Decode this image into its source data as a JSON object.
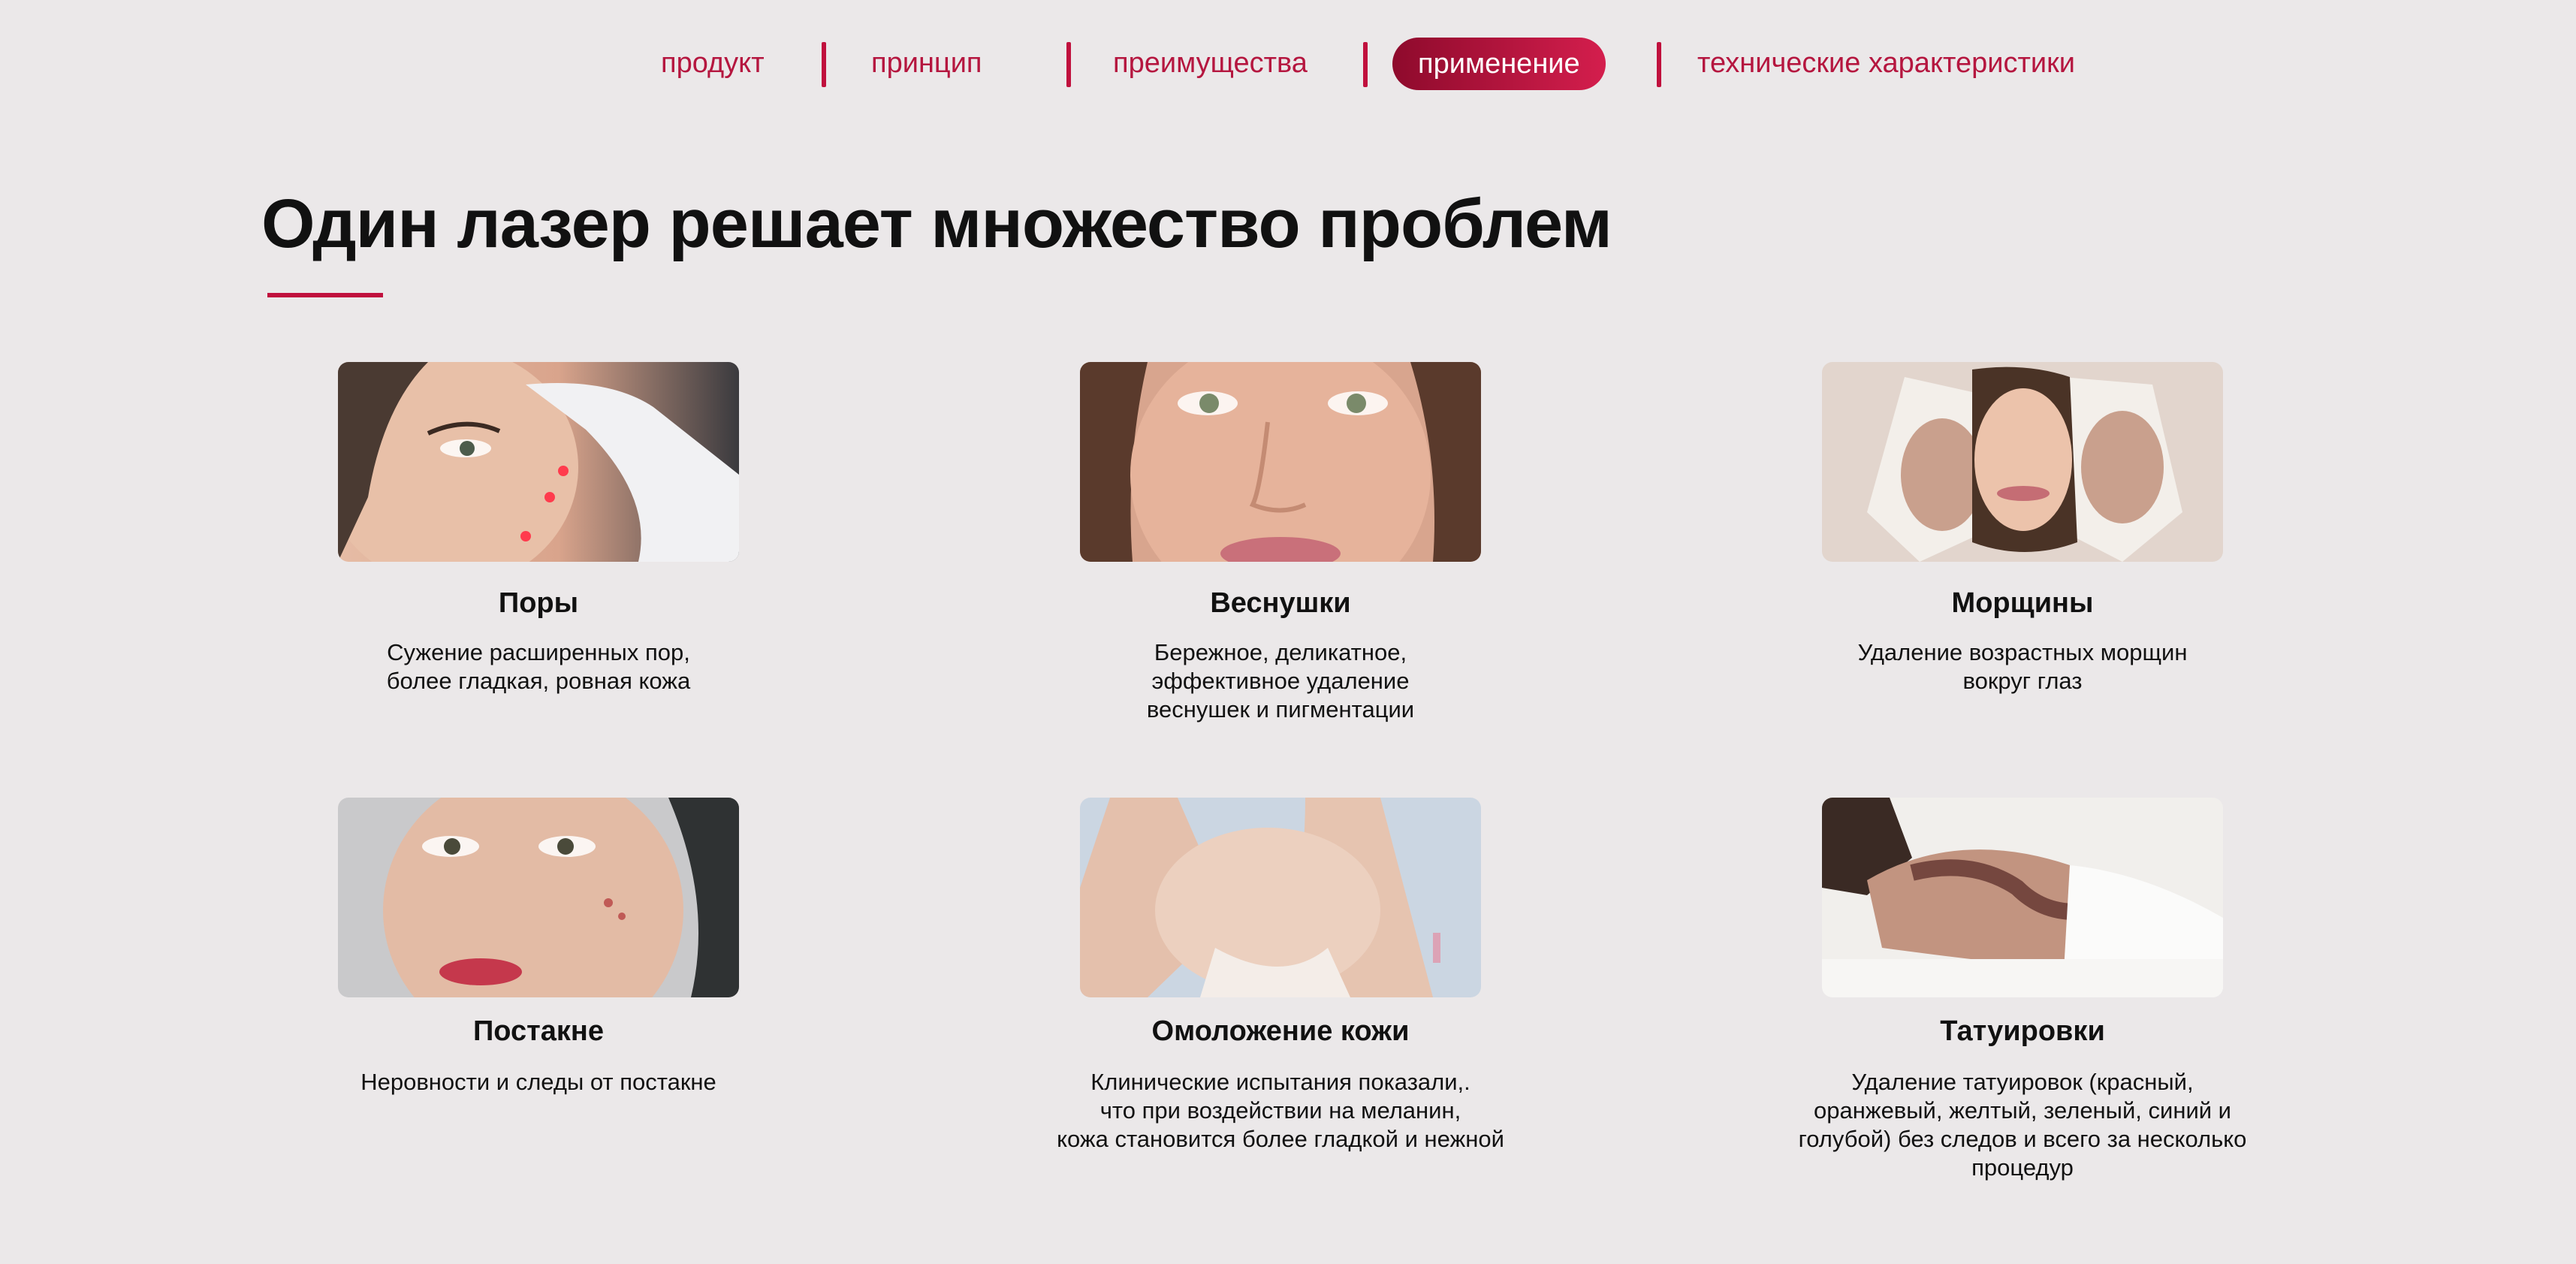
{
  "nav": {
    "items": [
      {
        "label": "продукт"
      },
      {
        "label": "принцип"
      },
      {
        "label": "преимущества"
      },
      {
        "label": "применение"
      },
      {
        "label": "технические характеристики"
      }
    ],
    "active_index": 3
  },
  "main": {
    "title": "Один лазер решает множество проблем",
    "cards": [
      {
        "name": "Поры",
        "description": "Сужение расширенных пор,\nболее гладкая, ровная кожа"
      },
      {
        "name": "Веснушки",
        "description": "Бережное, деликатное,\nэффективное удаление\nвеснушек и пигментации"
      },
      {
        "name": "Морщины",
        "description": "Удаление возрастных морщин\nвокруг глаз"
      },
      {
        "name": "Постакне",
        "description": "Неровности и следы от постакне"
      },
      {
        "name": "Омоложение кожи",
        "description": "Клинические испытания показали,.\nчто при воздействии на меланин,\nкожа становится более гладкой и нежной"
      },
      {
        "name": "Татуировки",
        "description": "Удаление татуировок (красный,\nоранжевый, желтый, зеленый, синий и\nголубой) без следов и всего за несколько\nпроцедур"
      }
    ]
  },
  "colors": {
    "accent": "#c0103d",
    "background": "#ebe8e9"
  }
}
